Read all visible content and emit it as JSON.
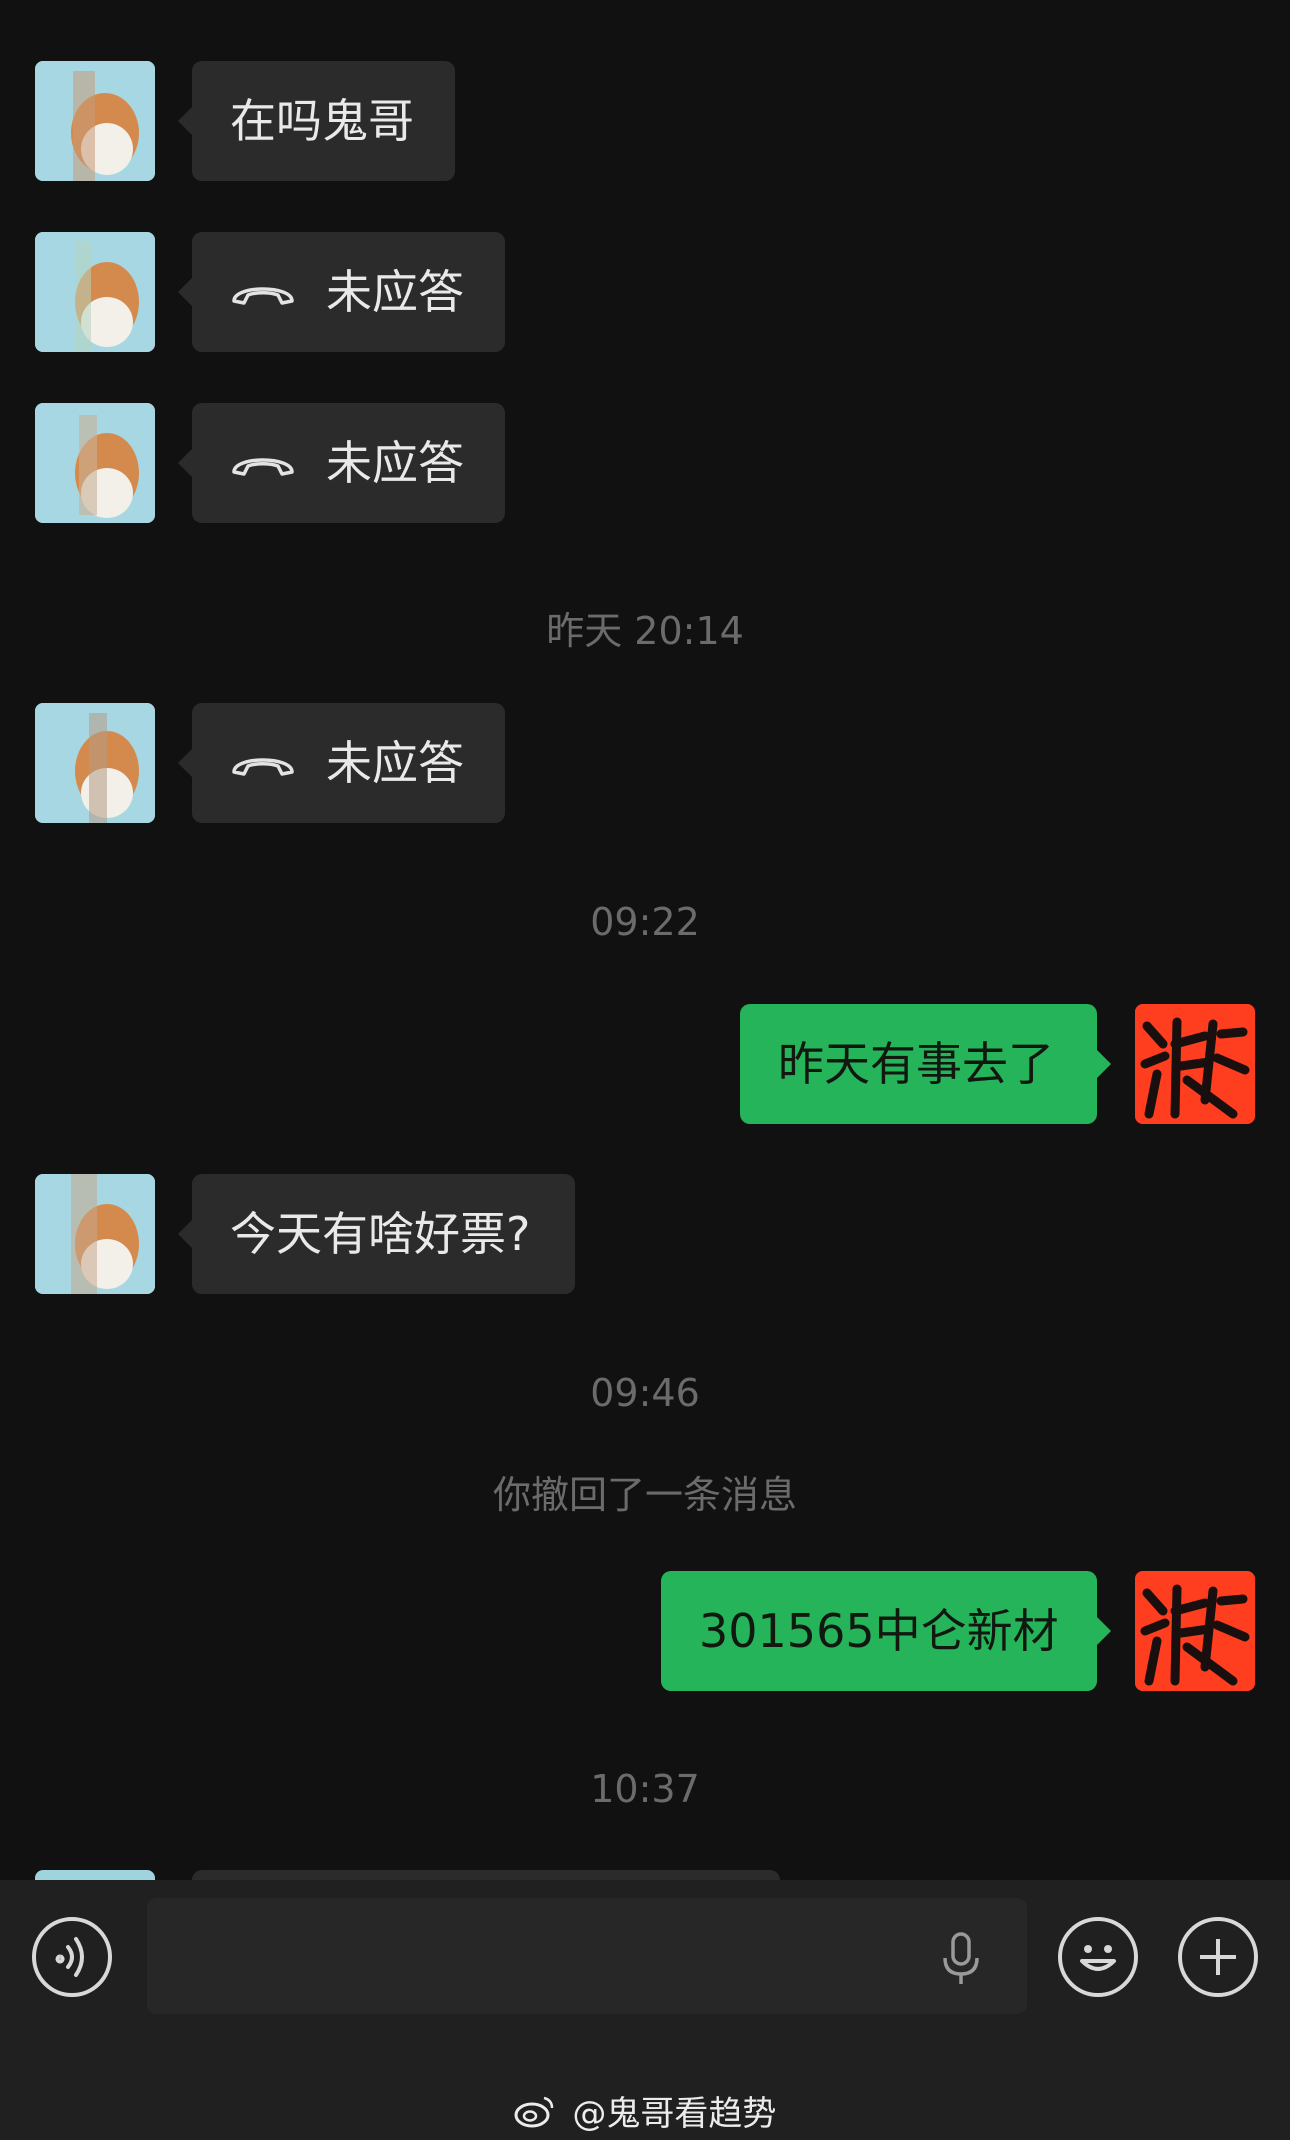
{
  "messages": {
    "m1": {
      "text": "在吗鬼哥"
    },
    "m2": {
      "text": "未应答"
    },
    "m3": {
      "text": "未应答"
    },
    "time1": "昨天 20:14",
    "m4": {
      "text": "未应答"
    },
    "time2": "09:22",
    "m5": {
      "text": "昨天有事去了"
    },
    "m6": {
      "text": "今天有啥好票?"
    },
    "time3": "09:46",
    "system_recall": "你撤回了一条消息",
    "m7": {
      "text": "301565中仑新材"
    },
    "time4": "10:37"
  },
  "toolbar": {
    "voice_icon": "voice-icon",
    "mic_icon": "mic-icon",
    "emoji_icon": "emoji-icon",
    "plus_icon": "plus-icon"
  },
  "watermark": {
    "text": "@鬼哥看趋势"
  },
  "colors": {
    "background": "#111111",
    "incoming_bubble": "#2b2b2b",
    "outgoing_bubble": "#26b45a",
    "timestamp": "#6b6b6b",
    "my_avatar": "#ff3d1f"
  }
}
